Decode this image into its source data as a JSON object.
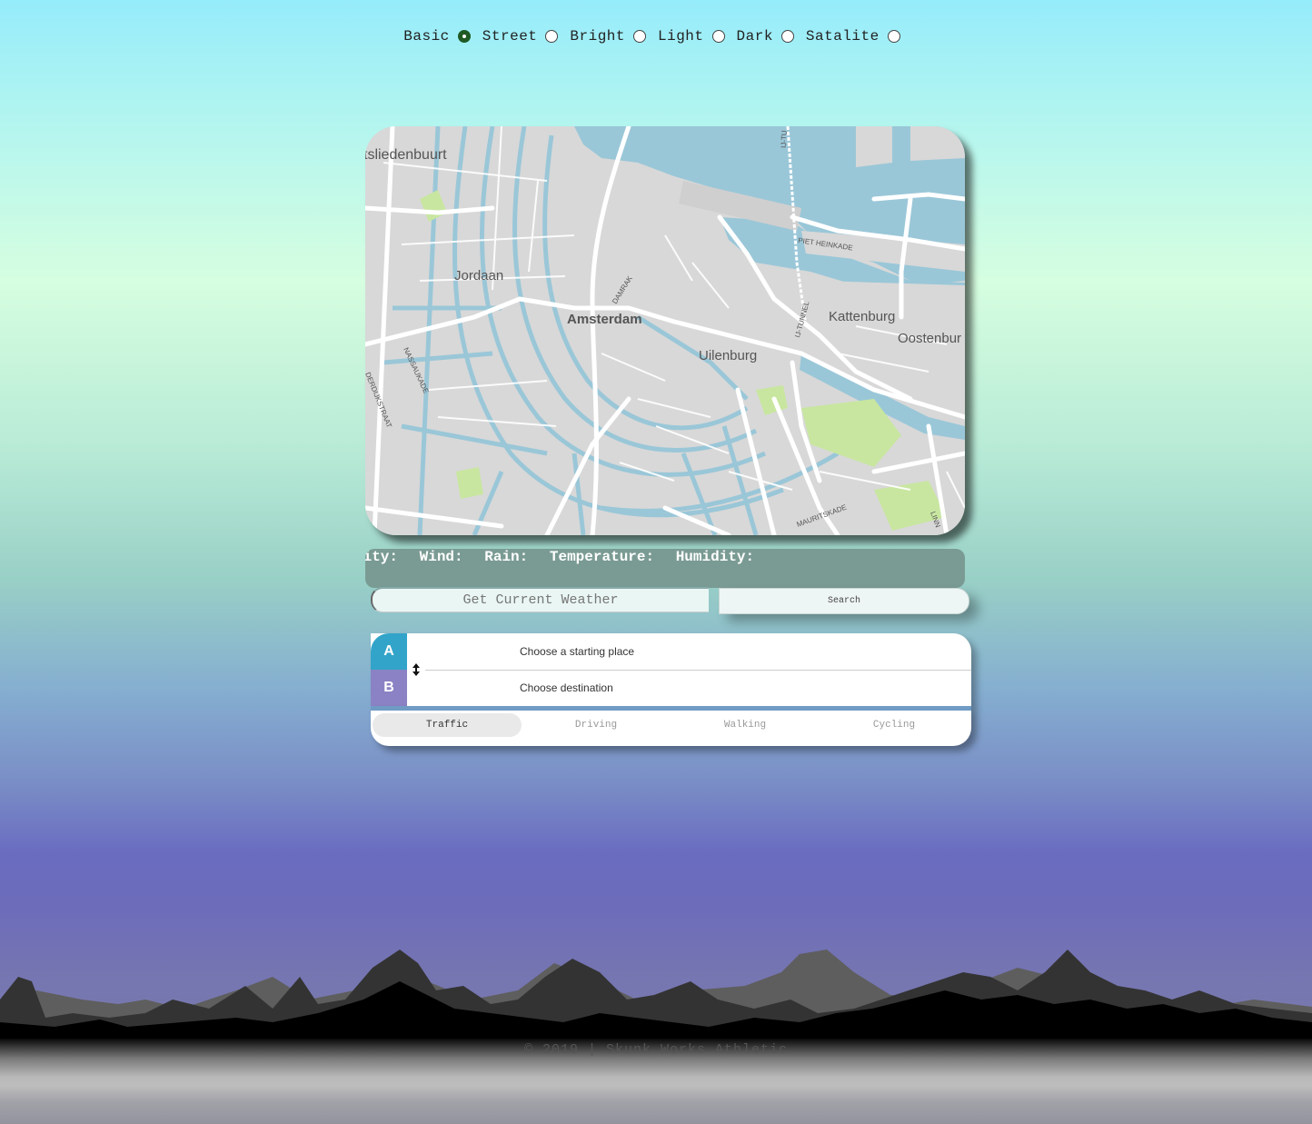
{
  "map_styles": [
    {
      "label": "Basic",
      "checked": true
    },
    {
      "label": "Street",
      "checked": false
    },
    {
      "label": "Bright",
      "checked": false
    },
    {
      "label": "Light",
      "checked": false
    },
    {
      "label": "Dark",
      "checked": false
    },
    {
      "label": "Satalite",
      "checked": false
    }
  ],
  "map": {
    "labels": {
      "westerpark": "tsliedenbuurt",
      "jordaan": "Jordaan",
      "amsterdam": "Amsterdam",
      "uilenburg": "Uilenburg",
      "kattenburg": "Kattenburg",
      "oostenburg": "Oostenbur",
      "piet_heinkade": "PIET HEINKADE",
      "ij_tunnel": "IJ-TUNNEL",
      "ij_tunnel_top": "IJ-TU",
      "damrak": "DAMRAK",
      "nassaukade": "NASSAUKADE",
      "bilderdijkstraat": "DERDIJKSTRAAT",
      "mauritskade": "MAURITSKADE",
      "linnaeus": "LINN"
    },
    "colors": {
      "land": "#d8d8d8",
      "water": "#9ac7d8",
      "park": "#c8e6a0",
      "road": "#ffffff"
    }
  },
  "weather": {
    "fields": [
      "lity:",
      "Wind:",
      "Rain:",
      "Temperature:",
      "Humidity:"
    ],
    "input_placeholder": "Get Current Weather",
    "search_label": "Search"
  },
  "directions": {
    "marker_a": "A",
    "marker_b": "B",
    "origin_placeholder": "Choose a starting place",
    "destination_placeholder": "Choose destination",
    "profiles": [
      "Traffic",
      "Driving",
      "Walking",
      "Cycling"
    ],
    "active_profile": "Traffic",
    "colors": {
      "a": "#33a4c9",
      "b": "#8a82c4"
    }
  },
  "footer": {
    "text": "© 2019 | Skunk Works Athletic"
  }
}
